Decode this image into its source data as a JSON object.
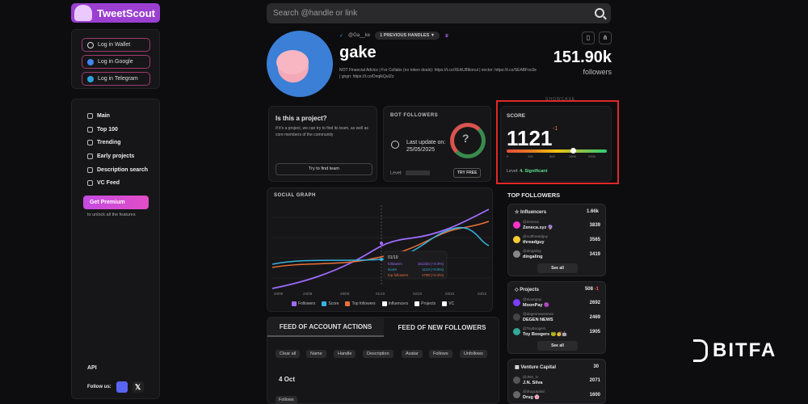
{
  "brand": {
    "name": "TweetScout"
  },
  "login": [
    {
      "label": "Log in Wallet",
      "color": "#a13a6f"
    },
    {
      "label": "Log in Google",
      "color": "#4285f4"
    },
    {
      "label": "Log in Telegram",
      "color": "#2aa3e0"
    }
  ],
  "nav": [
    {
      "label": "Main",
      "icon": "diamond-icon"
    },
    {
      "label": "Top 100",
      "icon": "trophy-icon"
    },
    {
      "label": "Trending",
      "icon": "trending-icon"
    },
    {
      "label": "Early projects",
      "icon": "rocket-icon"
    },
    {
      "label": "Description search",
      "icon": "search-icon"
    },
    {
      "label": "VC Feed",
      "icon": "feed-icon"
    }
  ],
  "premium": {
    "label": "Get Premium",
    "sub": "to unlock all the features"
  },
  "footer": {
    "api": "API",
    "follow": "Follow us:"
  },
  "search": {
    "placeholder": "Search @handle or link"
  },
  "profile": {
    "handle": "@Ga__ke",
    "prev_handles": "1 PREVIOUS HANDLES ▼",
    "name": "gake",
    "bio": "NOT Financial Advice | For Collabs (no token deals): https://t.co/XEAU8Ikonul | vector: https://t.co/SEABFoc0e | gngn: https://t.co/DnqlkQuIZz",
    "followers": "151.90k",
    "followers_label": "followers"
  },
  "project": {
    "title": "Is this a project?",
    "desc": "If it's a project, we can try to find its team, as well as core members of the community",
    "button": "Try to find team"
  },
  "bot": {
    "title": "BOT FOLLOWERS",
    "update_line1": "Last update on:",
    "update_line2": "25/05/2025",
    "level_label": "Level:",
    "try": "TRY FREE",
    "mark": "?"
  },
  "score": {
    "title": "SCORE",
    "value": "1121",
    "delta": "-1",
    "ticks": [
      "0",
      "100",
      "500",
      "1000",
      "2000"
    ],
    "level_label": "Level:",
    "level_value": "4. Significant",
    "showcase": "SHOWCASE"
  },
  "graph": {
    "title": "SOCIAL GRAPH",
    "x_labels": [
      "20/09",
      "24/09",
      "28/09",
      "01/10",
      "02/10",
      "03/10",
      "04/10"
    ],
    "tooltip": {
      "date": "01/10",
      "rows": [
        {
          "label": "followers",
          "value": "151334 (+0.3%)",
          "color": "#a06bff"
        },
        {
          "label": "score",
          "value": "1114 (+0.5%)",
          "color": "#37b3e0"
        },
        {
          "label": "top followers",
          "value": "1708 (+0.3%)",
          "color": "#e8703a"
        }
      ]
    },
    "legend": [
      {
        "label": "Followers",
        "color": "#a06bff"
      },
      {
        "label": "Score",
        "color": "#37b3e0"
      },
      {
        "label": "Top followers",
        "color": "#e8703a"
      },
      {
        "label": "Influencers",
        "color": "#ffffff"
      },
      {
        "label": "Projects",
        "color": "#ffffff"
      },
      {
        "label": "VC",
        "color": "#ffffff"
      }
    ]
  },
  "feed": {
    "tab_actions": "FEED OF ACCOUNT ACTIONS",
    "tab_followers": "FEED OF NEW FOLLOWERS",
    "filters": [
      "Clear all",
      "Name",
      "Handle",
      "Description",
      "Avatar",
      "Follows",
      "Unfollows"
    ],
    "date": "4 Oct",
    "first_item": "Follows"
  },
  "top_followers": {
    "title": "TOP FOLLOWERS",
    "groups": [
      {
        "name": "Influencers",
        "count": "1.66k",
        "rows": [
          {
            "handle": "@Zeneca",
            "name": "Zeneca.xyz 🔮",
            "value": "3839",
            "color": "#f3c"
          },
          {
            "handle": "@notthreadguy",
            "name": "threadguy",
            "value": "3565",
            "color": "#fc3"
          },
          {
            "handle": "@dingaling",
            "name": "dingaling",
            "value": "3419",
            "color": "#888"
          }
        ],
        "see_all": "See all"
      },
      {
        "name": "Projects",
        "count": "508",
        "delta": "-1",
        "rows": [
          {
            "handle": "@moonpay",
            "name": "MoonPay 🟣",
            "value": "2692",
            "color": "#7d3cff"
          },
          {
            "handle": "@degennewsnews",
            "name": "DEGEN NEWS",
            "value": "2469",
            "color": "#444"
          },
          {
            "handle": "@ToyBoogers",
            "name": "Toy Boogers 🐸🥳🤖",
            "value": "1905",
            "color": "#3a9"
          }
        ],
        "see_all": "See all"
      },
      {
        "name": "Venture Capital",
        "count": "30",
        "rows": [
          {
            "handle": "@JNS_lv",
            "name": "J.N. Silva",
            "value": "2071",
            "color": "#555"
          },
          {
            "handle": "@drugcapital",
            "name": "Drug 🌸",
            "value": "1600",
            "color": "#666"
          }
        ]
      }
    ]
  },
  "watermark": "BITFA"
}
